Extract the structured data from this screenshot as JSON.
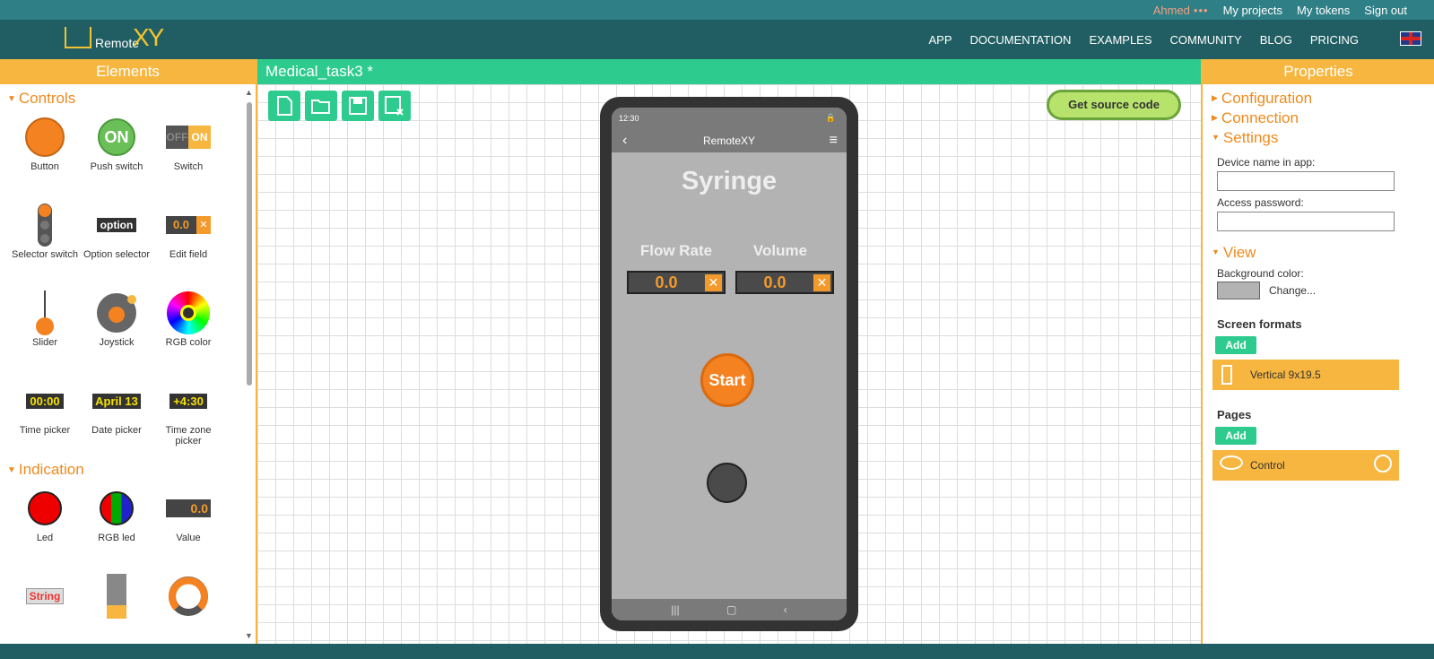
{
  "topbar": {
    "user": "Ahmed",
    "dots": "•••",
    "links": [
      "My projects",
      "My tokens",
      "Sign out"
    ]
  },
  "logo": {
    "text": "Remote",
    "mark": "XY"
  },
  "nav": [
    "APP",
    "DOCUMENTATION",
    "EXAMPLES",
    "COMMUNITY",
    "BLOG",
    "PRICING"
  ],
  "left": {
    "title": "Elements",
    "controls_title": "Controls",
    "controls": [
      "Button",
      "Push switch",
      "Switch",
      "Selector switch",
      "Option selector",
      "Edit field",
      "Slider",
      "Joystick",
      "RGB color",
      "Time picker",
      "Date picker",
      "Time zone picker"
    ],
    "indication_title": "Indication",
    "indication": [
      "Led",
      "RGB led",
      "Value"
    ],
    "icon_text": {
      "push": "ON",
      "switch_off": "OFF",
      "switch_on": "ON",
      "option": "option",
      "edit": "0.0",
      "time": "00:00",
      "date": "April 13",
      "tz": "+4:30",
      "value": "0.0",
      "string": "String"
    }
  },
  "center": {
    "tab": "Medical_task3 *",
    "get_source": "Get source code"
  },
  "phone": {
    "time": "12:30",
    "title": "RemoteXY",
    "heading": "Syringe",
    "flow_label": "Flow Rate",
    "volume_label": "Volume",
    "flow_value": "0.0",
    "volume_value": "0.0",
    "start": "Start"
  },
  "right": {
    "title": "Properties",
    "configuration": "Configuration",
    "connection": "Connection",
    "settings": "Settings",
    "device_name_label": "Device name in app:",
    "password_label": "Access password:",
    "view": "View",
    "bg_label": "Background color:",
    "change": "Change...",
    "screen_formats": "Screen formats",
    "add": "Add",
    "format": "Vertical 9x19.5",
    "pages": "Pages",
    "page": "Control"
  },
  "colors": {
    "accent": "#f6b63f",
    "green": "#2ecb8e",
    "header": "#215e63",
    "orange": "#f58220"
  }
}
